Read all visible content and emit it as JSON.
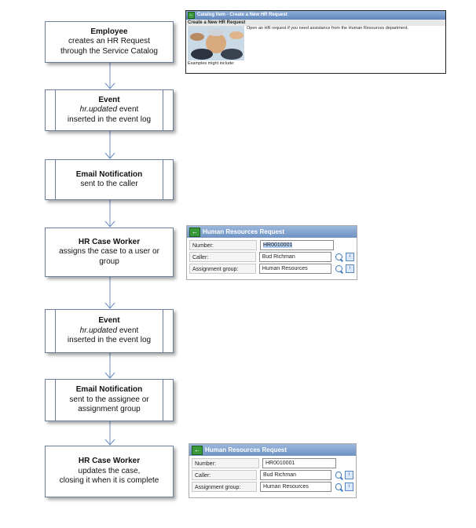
{
  "steps": [
    {
      "title": "Employee",
      "line1": "creates an HR Request",
      "line2": "through the Service Catalog"
    },
    {
      "title": "Event",
      "italic": "hr.updated",
      "line1": " event",
      "line2": "inserted in the event log"
    },
    {
      "title": "Email Notification",
      "line1": "sent to the caller"
    },
    {
      "title": "HR Case Worker",
      "line1": "assigns the case to a user or",
      "line2": "group"
    },
    {
      "title": "Event",
      "italic": "hr.updated",
      "line1": " event",
      "line2": "inserted in the event log"
    },
    {
      "title": "Email Notification",
      "line1": "sent to the assignee or",
      "line2": "assignment group"
    },
    {
      "title": "HR Case Worker",
      "line1": "updates the case,",
      "line2": "closing it when it is complete"
    }
  ],
  "catalog": {
    "header": "Catalog Item - Create a New HR Request",
    "title": "Create a New HR Request",
    "description": "Open an HR request if you need assistance from the Human Resources department.",
    "examples": "Examples might include:"
  },
  "hr_form_1": {
    "header": "Human Resources Request",
    "number_label": "Number:",
    "number_value": "HR0010001",
    "caller_label": "Caller:",
    "caller_value": "Bud Richman",
    "group_label": "Assignment group:",
    "group_value": "Human Resources"
  },
  "hr_form_2": {
    "header": "Human Resources Request",
    "number_label": "Number:",
    "number_value": "HR0010001",
    "caller_label": "Caller:",
    "caller_value": "Bud Richman",
    "group_label": "Assignment group:",
    "group_value": "Human Resources"
  },
  "colors": {
    "connector": "#6a8cc0",
    "box_border": "#6b7f9a",
    "header_blue": "#6d92c4"
  }
}
